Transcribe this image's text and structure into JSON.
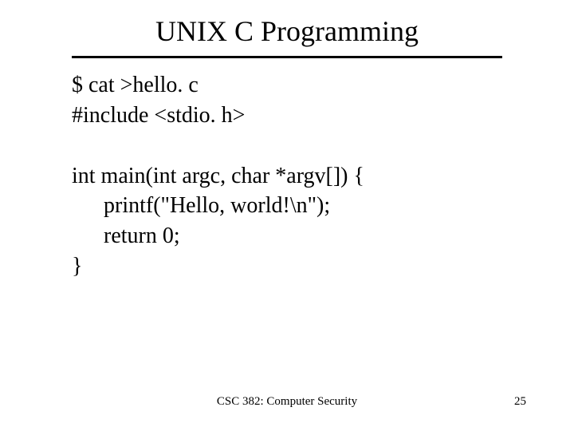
{
  "title": "UNIX C Programming",
  "code": {
    "l1": "$ cat >hello. c",
    "l2": "#include <stdio. h>",
    "l3": "int main(int argc, char *argv[]) {",
    "l4": "printf(\"Hello, world!\\n\");",
    "l5": "return 0;",
    "l6": "}"
  },
  "footer": {
    "course": "CSC 382: Computer Security",
    "page": "25"
  }
}
